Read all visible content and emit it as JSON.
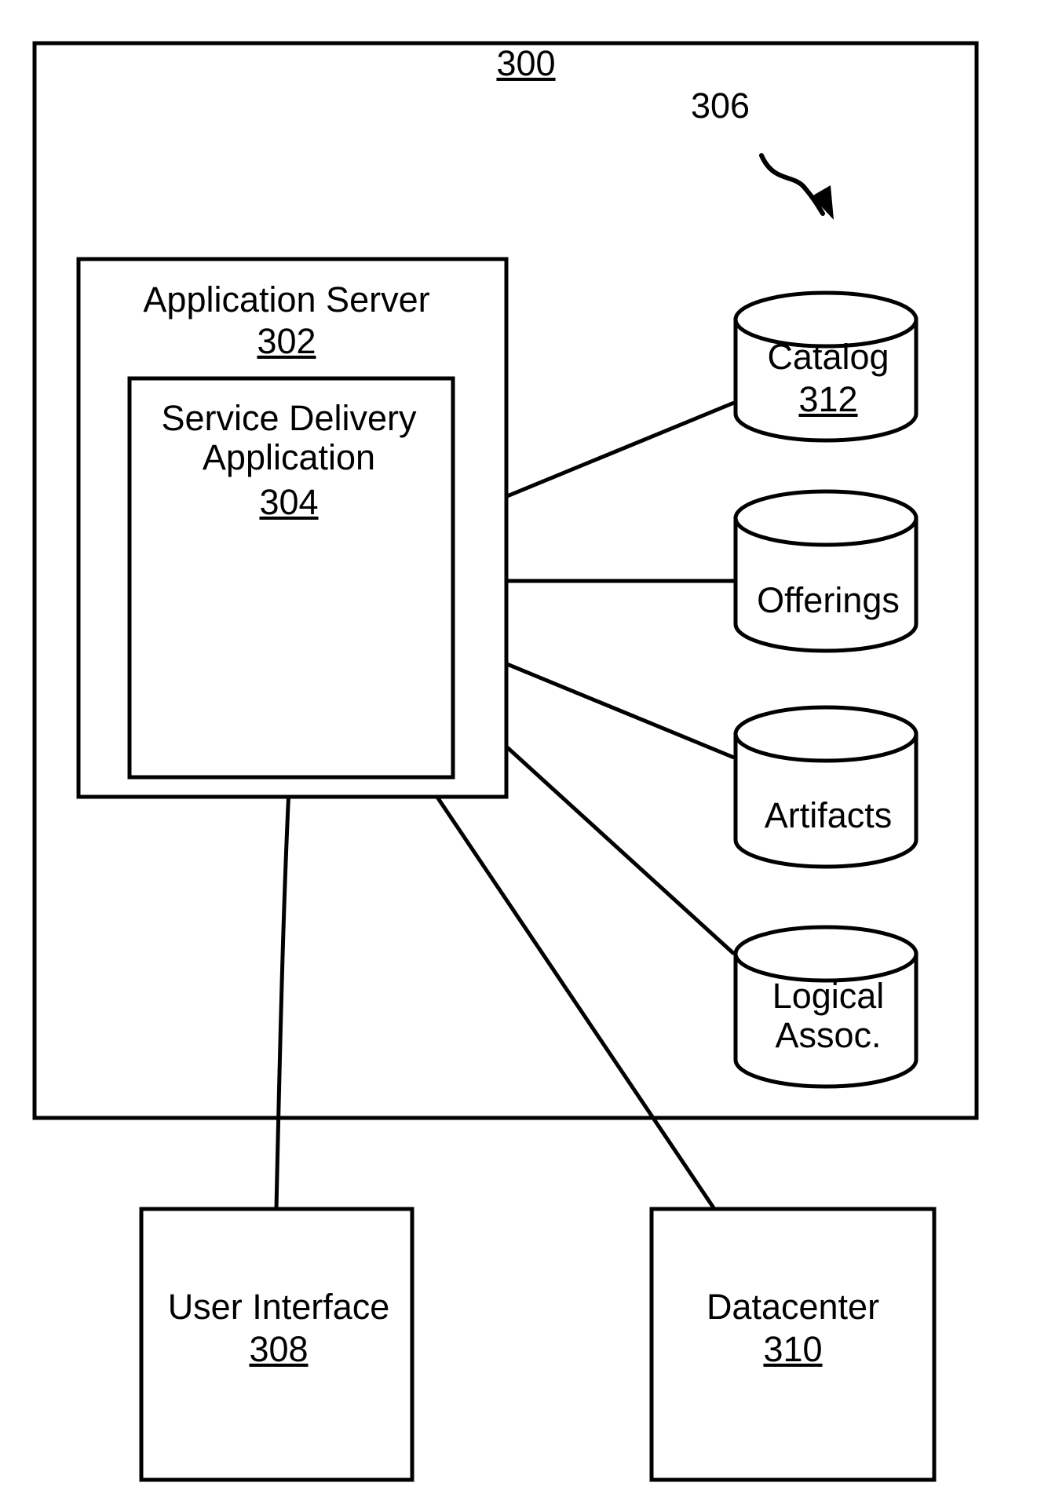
{
  "figure": {
    "number": "300",
    "callout": "306"
  },
  "nodes": {
    "application_server": {
      "label": "Application Server",
      "number": "302"
    },
    "service_delivery_application": {
      "label": "Service Delivery\nApplication",
      "number": "304"
    },
    "user_interface": {
      "label": "User Interface",
      "number": "308"
    },
    "datacenter": {
      "label": "Datacenter",
      "number": "310"
    }
  },
  "datastores": [
    {
      "label": "Catalog",
      "number": "312"
    },
    {
      "label": "Offerings",
      "number": ""
    },
    {
      "label": "Artifacts",
      "number": ""
    },
    {
      "label": "Logical\nAssoc.",
      "number": ""
    }
  ],
  "style": {
    "stroke": "#000000",
    "fill": "#ffffff"
  }
}
